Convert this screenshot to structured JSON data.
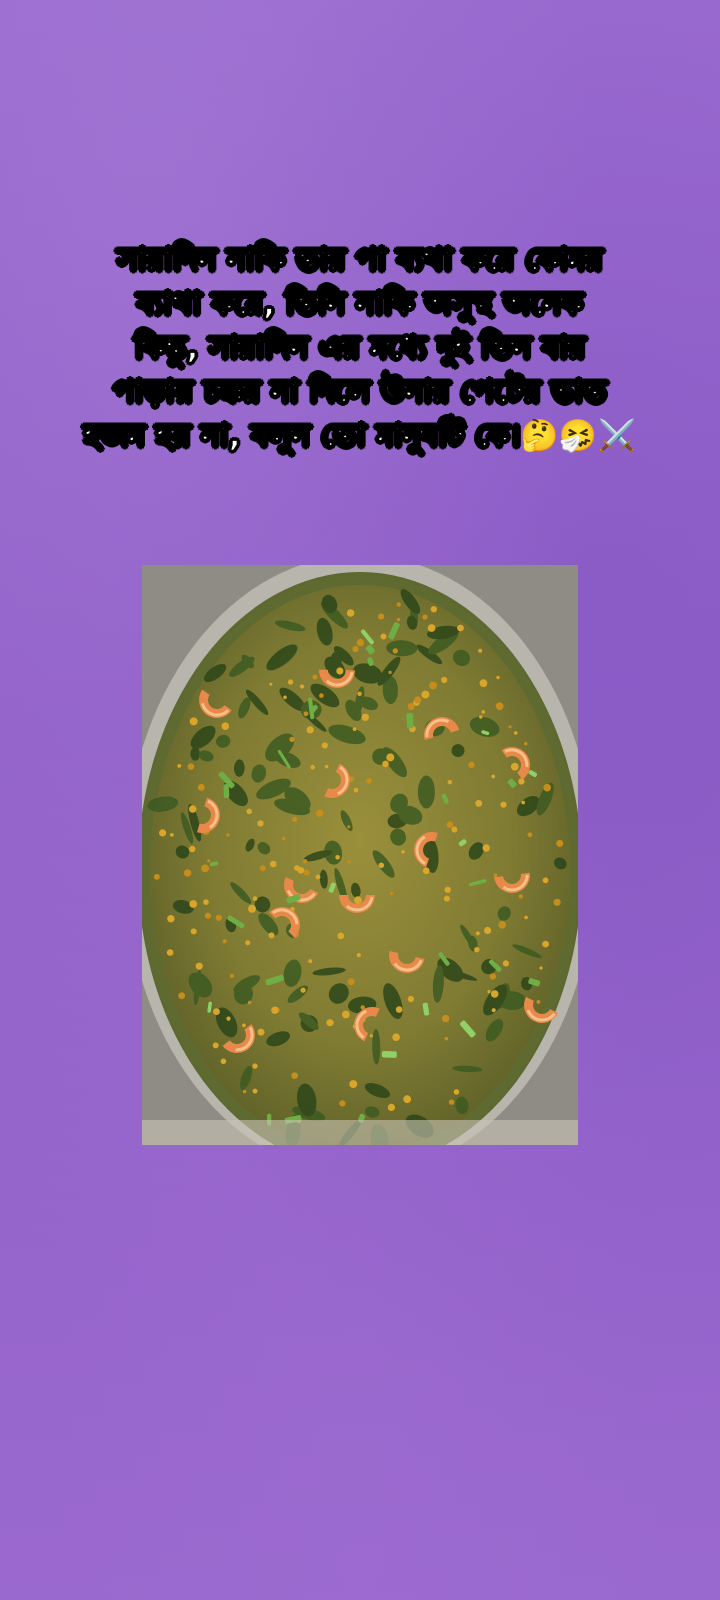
{
  "post": {
    "caption_lines": [
      "সারাদিন নাকি তার পা ব্যথা করে কোমর",
      "ব্যাথা করে, তিনি নাকি অসুস্থ অনেক",
      "কিন্তু, সারাদিন এর মধ্যে দুই তিন বার",
      "পাড়ায় চক্কর না দিলে উনার পেটের ভাত",
      "হজম হয় না, বলুন তো মানুষটি কে।"
    ],
    "caption_emojis": "🤔🤧⚔️",
    "image_icon": "food-photo-shrimp-spinach-dal"
  },
  "colors": {
    "background": "#9466cc",
    "caption_text": "#ffffff",
    "caption_outline": "#000000"
  }
}
